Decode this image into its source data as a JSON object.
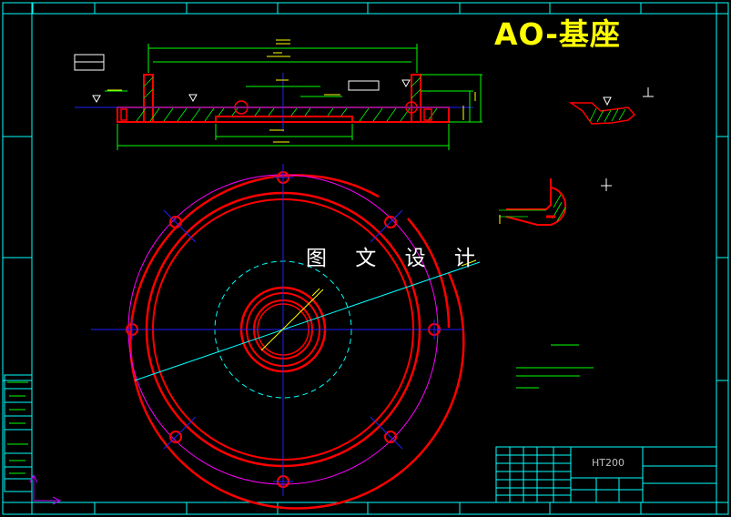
{
  "drawing": {
    "title": "AO-基座",
    "watermark": "图 文 设 计",
    "material": "HT200"
  },
  "colors": {
    "background": "#000000",
    "frame": "#00ffff",
    "part_outline": "#ff0000",
    "dimension": "#00ff00",
    "center_line": "#2020ff",
    "hidden_line": "#00ffff",
    "bolt_circle": "#ff00ff",
    "title": "#ffff00",
    "watermark": "#ffffff"
  }
}
